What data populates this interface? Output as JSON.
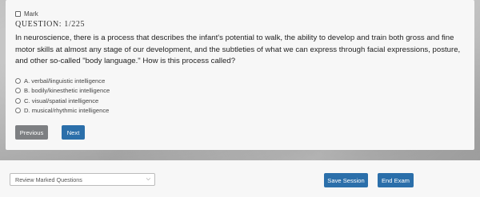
{
  "question": {
    "mark_label": "Mark",
    "number_label": "QUESTION: 1/225",
    "text": "In neuroscience, there is a process that describes the infant's potential to walk, the ability to develop and train both gross and fine motor skills at almost any stage of our development, and the subtleties of what we can express through facial expressions, posture, and other so-called \"body language.\" How is this process called?",
    "options": [
      {
        "label": "A. verbal/linguistic intelligence"
      },
      {
        "label": "B. bodily/kinesthetic intelligence"
      },
      {
        "label": "C. visual/spatial intelligence"
      },
      {
        "label": "D. musical/rhythmic intelligence"
      }
    ]
  },
  "navigation": {
    "previous_label": "Previous",
    "next_label": "Next"
  },
  "footer": {
    "review_select_value": "Review Marked Questions",
    "save_label": "Save Session",
    "end_label": "End Exam"
  }
}
